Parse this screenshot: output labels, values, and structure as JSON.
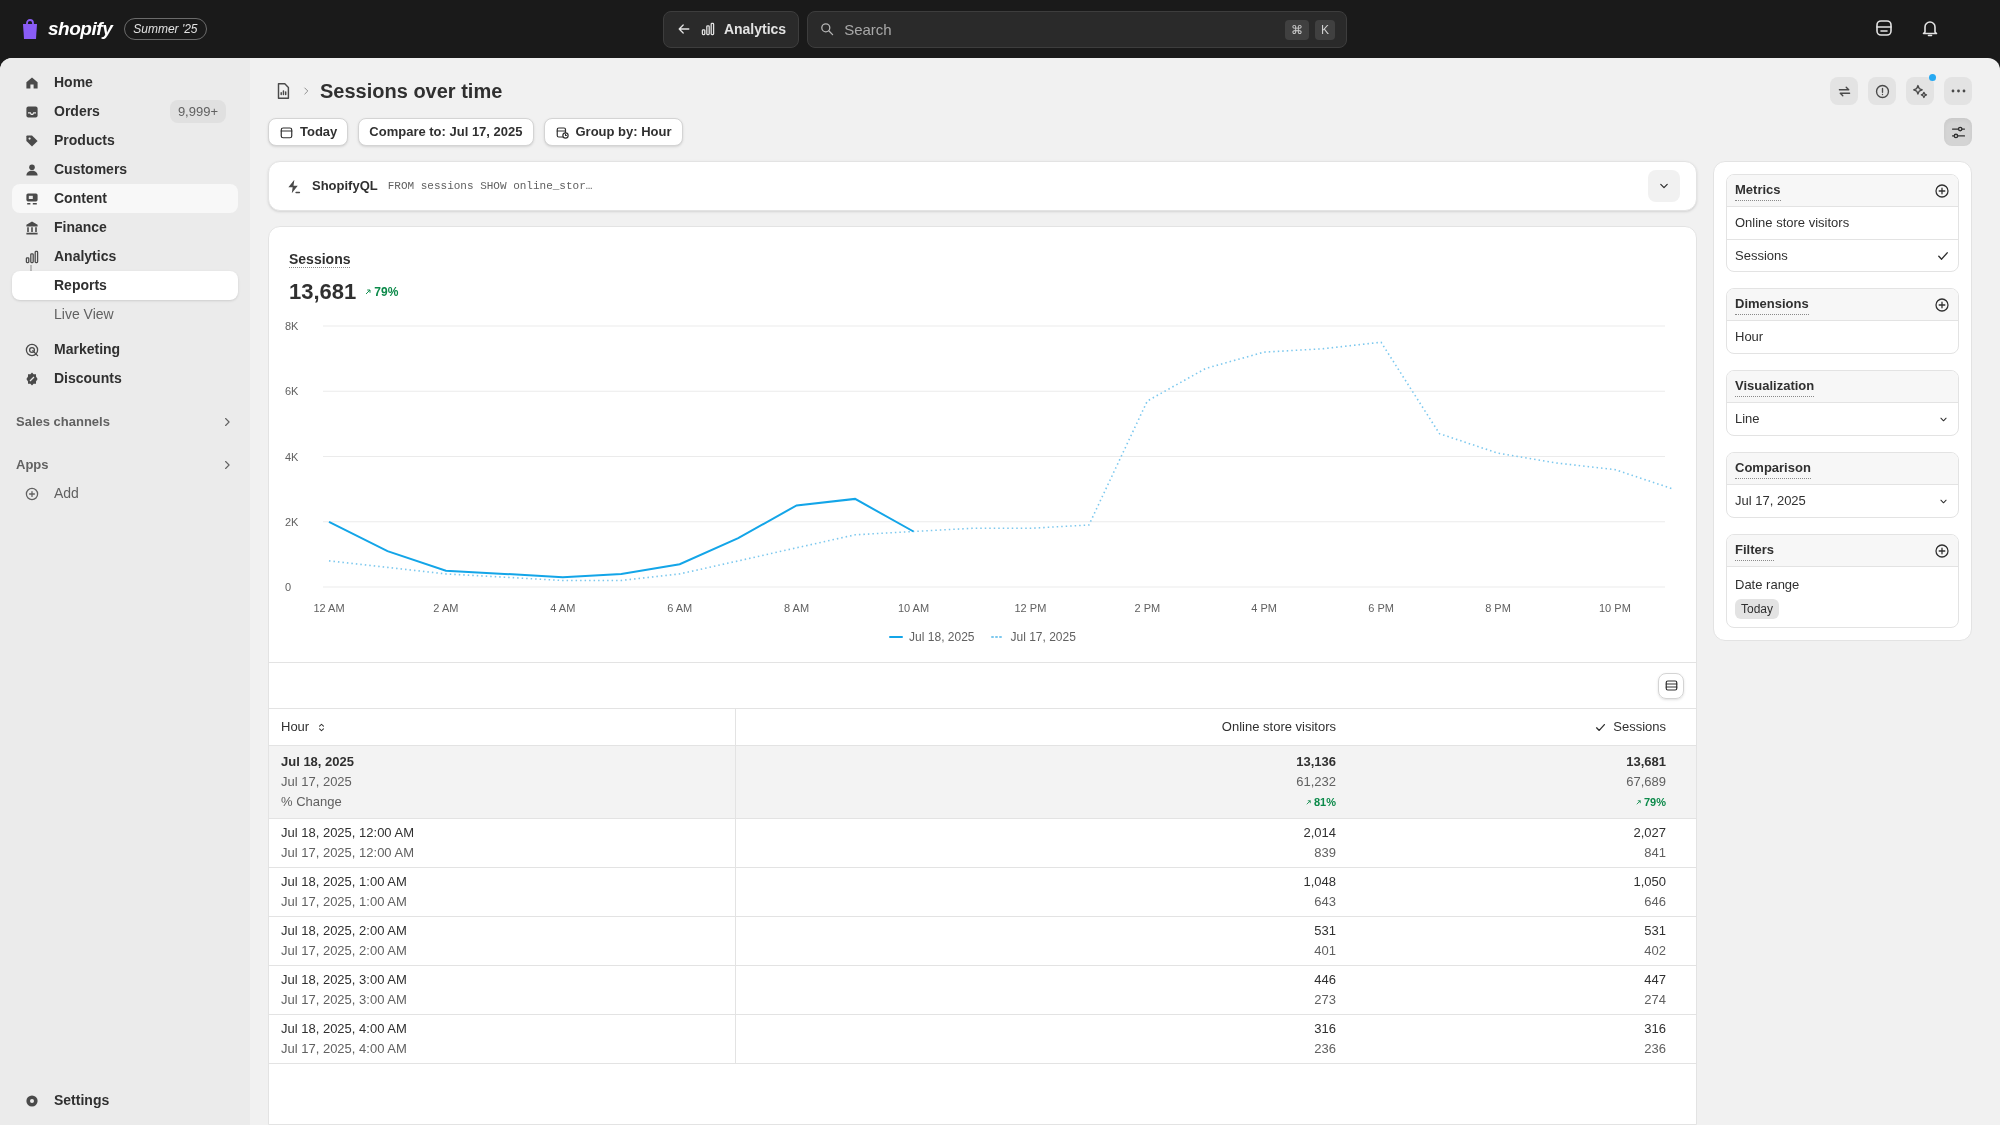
{
  "topbar": {
    "logo": "shopify",
    "badge": "Summer '25",
    "back_button": "Analytics",
    "search": {
      "placeholder": "Search",
      "keys": [
        "⌘",
        "K"
      ]
    }
  },
  "sidebar": {
    "items": [
      {
        "label": "Home",
        "selected": false
      },
      {
        "label": "Orders",
        "badge": "9,999+",
        "selected": false
      },
      {
        "label": "Products",
        "selected": false
      },
      {
        "label": "Customers",
        "selected": false
      },
      {
        "label": "Content",
        "selected": false,
        "hovered": true
      },
      {
        "label": "Finance",
        "selected": false
      },
      {
        "label": "Analytics",
        "selected": false,
        "children": [
          {
            "label": "Reports",
            "selected": true
          },
          {
            "label": "Live View",
            "selected": false
          }
        ]
      },
      {
        "label": "Marketing",
        "selected": false
      },
      {
        "label": "Discounts",
        "selected": false
      }
    ],
    "sections": [
      {
        "label": "Sales channels"
      },
      {
        "label": "Apps",
        "items": [
          {
            "label": "Add"
          }
        ]
      }
    ],
    "settings": "Settings"
  },
  "page": {
    "title": "Sessions over time",
    "toolbar": [
      {
        "label": "Today"
      },
      {
        "label": "Compare to: Jul 17, 2025"
      },
      {
        "label": "Group by: Hour"
      }
    ],
    "actions": [
      {
        "notify": false
      },
      {
        "notify": false
      },
      {
        "notify": true
      },
      {
        "notify": false
      }
    ],
    "panel_toggle": {
      "selected": true
    },
    "query": {
      "label": "ShopifyQL",
      "code": "FROM sessions SHOW online_stor…"
    },
    "chart_card": {
      "metric": "Sessions",
      "value": "13,681",
      "change": "79%",
      "chart_data": {
        "type": "line",
        "categories": [
          "12 AM",
          null,
          "2 AM",
          null,
          "4 AM",
          null,
          "6 AM",
          null,
          "8 AM",
          null,
          "10 AM",
          null,
          "12 PM",
          null,
          "2 PM",
          null,
          "4 PM",
          null,
          "6 PM",
          null,
          "8 PM",
          null,
          "10 PM",
          null
        ],
        "yticks": [
          {
            "value": 0,
            "label": "0"
          },
          {
            "value": 2000,
            "label": "2K"
          },
          {
            "value": 4000,
            "label": "4K"
          },
          {
            "value": 6000,
            "label": "6K"
          },
          {
            "value": 8000,
            "label": "8K"
          }
        ],
        "ylim": [
          0,
          8000
        ],
        "grid": true,
        "series": [
          {
            "name": "Jul 18, 2025",
            "color": "#13a5e8",
            "line_style": "solid",
            "values": [
              2000,
              1100,
              500,
              400,
              300,
              400,
              700,
              1500,
              2500,
              2700,
              1700,
              null,
              null,
              null,
              null,
              null,
              null,
              null,
              null,
              null,
              null,
              null,
              null,
              null
            ]
          },
          {
            "name": "Jul 17, 2025",
            "color": "#7cc8ee",
            "line_style": "dotted",
            "values": [
              800,
              600,
              400,
              300,
              200,
              200,
              400,
              800,
              1200,
              1600,
              1700,
              1800,
              1800,
              1900,
              5700,
              6700,
              7200,
              7300,
              7500,
              4700,
              4100,
              3800,
              3600,
              3000
            ]
          }
        ]
      }
    },
    "table": {
      "columns": [
        {
          "label": "Hour",
          "sortable": true,
          "checked": false
        },
        {
          "label": "Online store visitors",
          "sortable": false,
          "checked": false
        },
        {
          "label": "Sessions",
          "sortable": false,
          "checked": true
        }
      ],
      "summary": {
        "labels": [
          "Jul 18, 2025",
          "Jul 17, 2025",
          "% Change"
        ],
        "visitors": [
          "13,136",
          "61,232",
          "81%"
        ],
        "sessions": [
          "13,681",
          "67,689",
          "79%"
        ]
      },
      "rows": [
        {
          "hour": [
            "Jul 18, 2025, 12:00 AM",
            "Jul 17, 2025, 12:00 AM"
          ],
          "visitors": [
            "2,014",
            "839"
          ],
          "sessions": [
            "2,027",
            "841"
          ]
        },
        {
          "hour": [
            "Jul 18, 2025, 1:00 AM",
            "Jul 17, 2025, 1:00 AM"
          ],
          "visitors": [
            "1,048",
            "643"
          ],
          "sessions": [
            "1,050",
            "646"
          ]
        },
        {
          "hour": [
            "Jul 18, 2025, 2:00 AM",
            "Jul 17, 2025, 2:00 AM"
          ],
          "visitors": [
            "531",
            "401"
          ],
          "sessions": [
            "531",
            "402"
          ]
        },
        {
          "hour": [
            "Jul 18, 2025, 3:00 AM",
            "Jul 17, 2025, 3:00 AM"
          ],
          "visitors": [
            "446",
            "273"
          ],
          "sessions": [
            "447",
            "274"
          ]
        },
        {
          "hour": [
            "Jul 18, 2025, 4:00 AM",
            "Jul 17, 2025, 4:00 AM"
          ],
          "visitors": [
            "316",
            "236"
          ],
          "sessions": [
            "316",
            "236"
          ]
        }
      ]
    }
  },
  "panel": {
    "sections": [
      {
        "title": "Metrics",
        "addable": true,
        "items": [
          {
            "kind": "option",
            "label": "Online store visitors",
            "checked": false
          },
          {
            "kind": "option",
            "label": "Sessions",
            "checked": true
          }
        ]
      },
      {
        "title": "Dimensions",
        "addable": true,
        "items": [
          {
            "kind": "plain",
            "label": "Hour"
          }
        ]
      },
      {
        "title": "Visualization",
        "addable": false,
        "items": [
          {
            "kind": "select",
            "label": "Line"
          }
        ]
      },
      {
        "title": "Comparison",
        "addable": false,
        "items": [
          {
            "kind": "select",
            "label": "Jul 17, 2025"
          }
        ]
      },
      {
        "title": "Filters",
        "addable": true,
        "items": [
          {
            "kind": "filter",
            "label": "Date range",
            "tag": "Today"
          }
        ]
      }
    ]
  }
}
